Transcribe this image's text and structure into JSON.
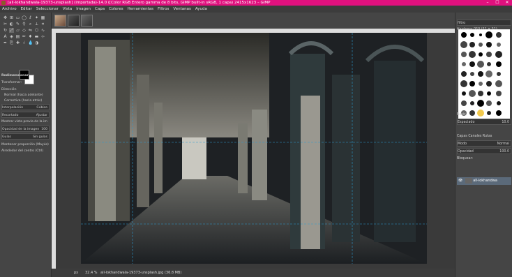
{
  "window": {
    "title": "[all-lokhandwala-19373-unsplash] (importada)-14.0 ([Color RGB Entero gamma de 8 bits, GIMP built-in sRGB, 1 capa) 2415x1623 – GIMP",
    "minimize": "–",
    "maximize": "☐",
    "close": "✕"
  },
  "menu": [
    "Archivo",
    "Editar",
    "Seleccionar",
    "Vista",
    "Imagen",
    "Capa",
    "Colores",
    "Herramientas",
    "Filtros",
    "Ventanas",
    "Ayuda"
  ],
  "tool_options": {
    "tool_name": "Redimensionar",
    "transform_label": "Transformar:",
    "direction_label": "Dirección",
    "direction_options": [
      "Normal (hacia adelante)",
      "Correctiva (hacia atrás)"
    ],
    "interpolation_label": "Interpolación",
    "interpolation_value": "Cúbico",
    "clipping_label": "Recortado",
    "clipping_value": "Ajustar",
    "preview_label": "Mostrar vista previa de la im",
    "opacity_label": "Opacidad de la imagen",
    "opacity_value": "100",
    "guides_label": "Guías",
    "guides_value": "Sin guías",
    "keep_aspect_label": "Mantener proporción (Mayús)",
    "around_center_label": "Alrededor del centro (Ctrl)"
  },
  "status": {
    "unit": "px",
    "zoom": "32.4 %",
    "filename": "all-lokhandwala-19373-unsplash.jpg (36.8 MB)"
  },
  "brushes": {
    "filter_placeholder": "filtro",
    "preset_name": "Hardness 050 (51 × 51)",
    "tag": "Basic,",
    "spacing_label": "Espaciado",
    "spacing_value": "10.0"
  },
  "layers": {
    "tabs": [
      "Capas",
      "Canales",
      "Rutas"
    ],
    "mode_label": "Modo",
    "mode_value": "Normal",
    "opacity_label": "Opacidad",
    "opacity_value": "100.0",
    "lock_label": "Bloquear:",
    "layer_name": "all-lokhandwa"
  }
}
